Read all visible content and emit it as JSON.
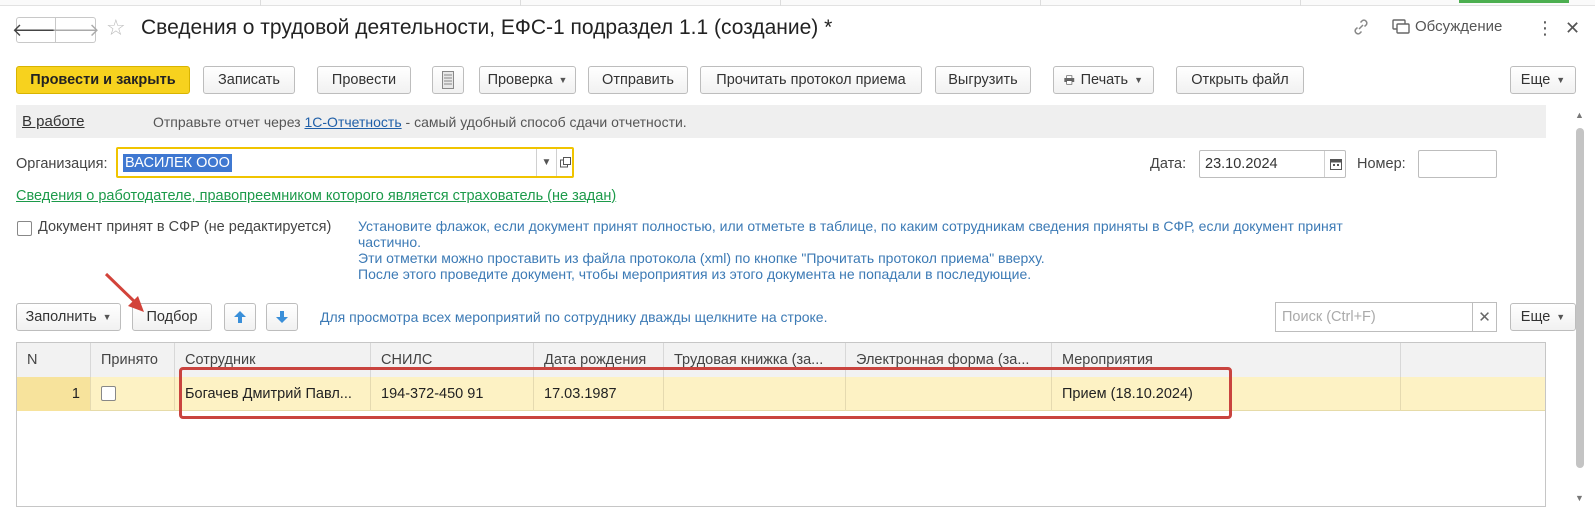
{
  "window": {
    "title": "Сведения о трудовой деятельности, ЕФС-1 подраздел 1.1 (создание) *",
    "discussion_label": "Обсуждение"
  },
  "toolbar": {
    "post_close": "Провести и закрыть",
    "save": "Записать",
    "post": "Провести",
    "check": "Проверка",
    "send": "Отправить",
    "read_protocol": "Прочитать протокол приема",
    "export": "Выгрузить",
    "print": "Печать",
    "open_file": "Открыть файл",
    "more": "Еще"
  },
  "info": {
    "status": "В работе",
    "message_before": "Отправьте отчет через",
    "message_link": "1С-Отчетность",
    "message_after": "- самый удобный способ сдачи отчетности."
  },
  "form": {
    "org_label": "Организация:",
    "org_value": "ВАСИЛЕК ООО",
    "date_label": "Дата:",
    "date_value": "23.10.2024",
    "number_label": "Номер:",
    "number_value": "",
    "employer_link": "Сведения о работодателе, правопреемником которого является страхователь (не задан)",
    "accepted_label": "Документ принят в СФР (не редактируется)",
    "hint_lines": [
      "Установите флажок, если документ принят полностью, или отметьте в таблице, по каким сотрудникам сведения приняты в СФР, если документ принят",
      "частично.",
      "Эти отметки можно проставить из файла протокола (xml) по кнопке \"Прочитать протокол приема\" вверху.",
      "После этого проведите документ, чтобы мероприятия из этого документа не попадали в последующие."
    ]
  },
  "table_toolbar": {
    "fill": "Заполнить",
    "pick": "Подбор",
    "hint": "Для просмотра всех мероприятий по сотруднику дважды щелкните на строке.",
    "search_placeholder": "Поиск (Ctrl+F)",
    "more": "Еще"
  },
  "table": {
    "columns": [
      "N",
      "Принято",
      "Сотрудник",
      "СНИЛС",
      "Дата рождения",
      "Трудовая книжка (за...",
      "Электронная форма (за...",
      "Мероприятия"
    ],
    "rows": [
      {
        "n": "1",
        "accepted": false,
        "employee": "Богачев Дмитрий Павл...",
        "snils": "194-372-450 91",
        "birth_date": "17.03.1987",
        "paper_book": "",
        "electronic_form": "",
        "events": "Прием (18.10.2024)"
      }
    ]
  },
  "colors": {
    "primary_button": "#f7d21e",
    "selected_row": "#fdf2c4",
    "hint_text": "#3c7ab5",
    "green_link": "#1c9a4a",
    "annotation_red": "#c9443f"
  }
}
